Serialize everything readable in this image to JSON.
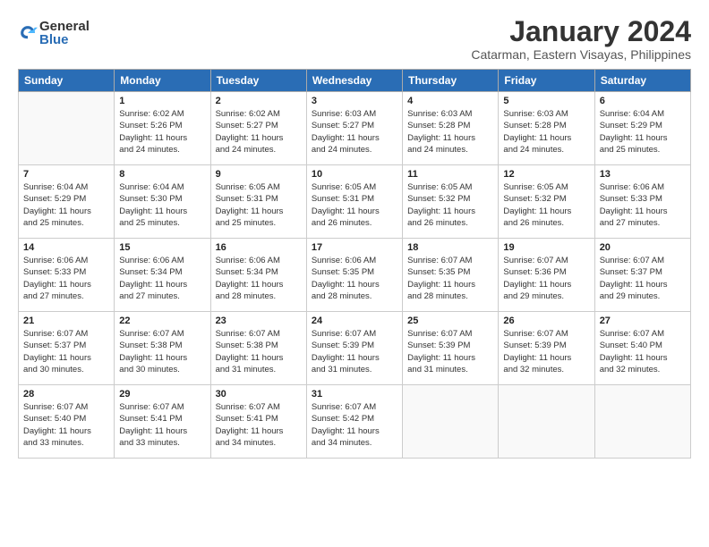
{
  "header": {
    "logo_general": "General",
    "logo_blue": "Blue",
    "month_title": "January 2024",
    "location": "Catarman, Eastern Visayas, Philippines"
  },
  "weekdays": [
    "Sunday",
    "Monday",
    "Tuesday",
    "Wednesday",
    "Thursday",
    "Friday",
    "Saturday"
  ],
  "weeks": [
    [
      {
        "day": "",
        "info": ""
      },
      {
        "day": "1",
        "info": "Sunrise: 6:02 AM\nSunset: 5:26 PM\nDaylight: 11 hours\nand 24 minutes."
      },
      {
        "day": "2",
        "info": "Sunrise: 6:02 AM\nSunset: 5:27 PM\nDaylight: 11 hours\nand 24 minutes."
      },
      {
        "day": "3",
        "info": "Sunrise: 6:03 AM\nSunset: 5:27 PM\nDaylight: 11 hours\nand 24 minutes."
      },
      {
        "day": "4",
        "info": "Sunrise: 6:03 AM\nSunset: 5:28 PM\nDaylight: 11 hours\nand 24 minutes."
      },
      {
        "day": "5",
        "info": "Sunrise: 6:03 AM\nSunset: 5:28 PM\nDaylight: 11 hours\nand 24 minutes."
      },
      {
        "day": "6",
        "info": "Sunrise: 6:04 AM\nSunset: 5:29 PM\nDaylight: 11 hours\nand 25 minutes."
      }
    ],
    [
      {
        "day": "7",
        "info": "Sunrise: 6:04 AM\nSunset: 5:29 PM\nDaylight: 11 hours\nand 25 minutes."
      },
      {
        "day": "8",
        "info": "Sunrise: 6:04 AM\nSunset: 5:30 PM\nDaylight: 11 hours\nand 25 minutes."
      },
      {
        "day": "9",
        "info": "Sunrise: 6:05 AM\nSunset: 5:31 PM\nDaylight: 11 hours\nand 25 minutes."
      },
      {
        "day": "10",
        "info": "Sunrise: 6:05 AM\nSunset: 5:31 PM\nDaylight: 11 hours\nand 26 minutes."
      },
      {
        "day": "11",
        "info": "Sunrise: 6:05 AM\nSunset: 5:32 PM\nDaylight: 11 hours\nand 26 minutes."
      },
      {
        "day": "12",
        "info": "Sunrise: 6:05 AM\nSunset: 5:32 PM\nDaylight: 11 hours\nand 26 minutes."
      },
      {
        "day": "13",
        "info": "Sunrise: 6:06 AM\nSunset: 5:33 PM\nDaylight: 11 hours\nand 27 minutes."
      }
    ],
    [
      {
        "day": "14",
        "info": "Sunrise: 6:06 AM\nSunset: 5:33 PM\nDaylight: 11 hours\nand 27 minutes."
      },
      {
        "day": "15",
        "info": "Sunrise: 6:06 AM\nSunset: 5:34 PM\nDaylight: 11 hours\nand 27 minutes."
      },
      {
        "day": "16",
        "info": "Sunrise: 6:06 AM\nSunset: 5:34 PM\nDaylight: 11 hours\nand 28 minutes."
      },
      {
        "day": "17",
        "info": "Sunrise: 6:06 AM\nSunset: 5:35 PM\nDaylight: 11 hours\nand 28 minutes."
      },
      {
        "day": "18",
        "info": "Sunrise: 6:07 AM\nSunset: 5:35 PM\nDaylight: 11 hours\nand 28 minutes."
      },
      {
        "day": "19",
        "info": "Sunrise: 6:07 AM\nSunset: 5:36 PM\nDaylight: 11 hours\nand 29 minutes."
      },
      {
        "day": "20",
        "info": "Sunrise: 6:07 AM\nSunset: 5:37 PM\nDaylight: 11 hours\nand 29 minutes."
      }
    ],
    [
      {
        "day": "21",
        "info": "Sunrise: 6:07 AM\nSunset: 5:37 PM\nDaylight: 11 hours\nand 30 minutes."
      },
      {
        "day": "22",
        "info": "Sunrise: 6:07 AM\nSunset: 5:38 PM\nDaylight: 11 hours\nand 30 minutes."
      },
      {
        "day": "23",
        "info": "Sunrise: 6:07 AM\nSunset: 5:38 PM\nDaylight: 11 hours\nand 31 minutes."
      },
      {
        "day": "24",
        "info": "Sunrise: 6:07 AM\nSunset: 5:39 PM\nDaylight: 11 hours\nand 31 minutes."
      },
      {
        "day": "25",
        "info": "Sunrise: 6:07 AM\nSunset: 5:39 PM\nDaylight: 11 hours\nand 31 minutes."
      },
      {
        "day": "26",
        "info": "Sunrise: 6:07 AM\nSunset: 5:39 PM\nDaylight: 11 hours\nand 32 minutes."
      },
      {
        "day": "27",
        "info": "Sunrise: 6:07 AM\nSunset: 5:40 PM\nDaylight: 11 hours\nand 32 minutes."
      }
    ],
    [
      {
        "day": "28",
        "info": "Sunrise: 6:07 AM\nSunset: 5:40 PM\nDaylight: 11 hours\nand 33 minutes."
      },
      {
        "day": "29",
        "info": "Sunrise: 6:07 AM\nSunset: 5:41 PM\nDaylight: 11 hours\nand 33 minutes."
      },
      {
        "day": "30",
        "info": "Sunrise: 6:07 AM\nSunset: 5:41 PM\nDaylight: 11 hours\nand 34 minutes."
      },
      {
        "day": "31",
        "info": "Sunrise: 6:07 AM\nSunset: 5:42 PM\nDaylight: 11 hours\nand 34 minutes."
      },
      {
        "day": "",
        "info": ""
      },
      {
        "day": "",
        "info": ""
      },
      {
        "day": "",
        "info": ""
      }
    ]
  ]
}
